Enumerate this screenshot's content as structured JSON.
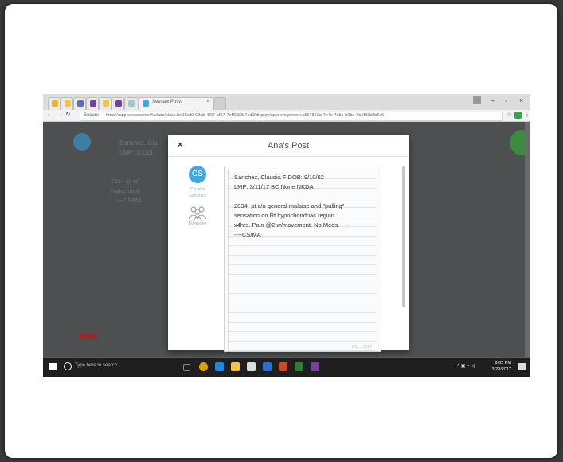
{
  "browser": {
    "tabs": [
      {
        "label": ""
      },
      {
        "label": ""
      },
      {
        "label": ""
      },
      {
        "label": ""
      },
      {
        "label": ""
      },
      {
        "label": ""
      },
      {
        "label": "Seesaw Posts"
      }
    ],
    "url": "https://app.seesaw.me/#/class/class.be91ed0-93ab-4f27-af67-7ef3252b7ed0/display/approve/person.a567852a-4e4e-4cbc-b9ba-6b1f93b0b5c6",
    "secure_label": "Secure"
  },
  "app_background": {
    "post_preview_line1": "Sanchez, Cla",
    "post_preview_line2": "LMP: 3/11/1",
    "post_preview_line3": "2034- pt c/",
    "post_preview_line4": "hypochondr",
    "post_preview_line5": "----CS/MA"
  },
  "modal": {
    "close_label": "×",
    "title": "Ana's Post",
    "avatar_initials": "CS",
    "author_name_1": "Claudia",
    "author_name_2": "Sanchez",
    "audience_label": "Everyone",
    "note_lines": [
      "Sanchez, Claudia F DOB: 9/10/62",
      "LMP: 3/11/17 BC:None NKDA",
      "",
      "2034- pt c/o general malaise and \"pulling\"",
      "sensation on Rt hypochondriac region",
      "x4hrs. Pain @2 w/movement. No Meds. ----",
      "----CS/MA"
    ],
    "note_footer": "3/1 ... 2017"
  },
  "taskbar": {
    "search_placeholder": "Type here to search",
    "time": "9:02 PM",
    "date": "3/29/2017"
  },
  "colors": {
    "avatar": "#3fa9e6",
    "fab": "#3e8a3e",
    "taskbar": "#1f1f1f"
  }
}
